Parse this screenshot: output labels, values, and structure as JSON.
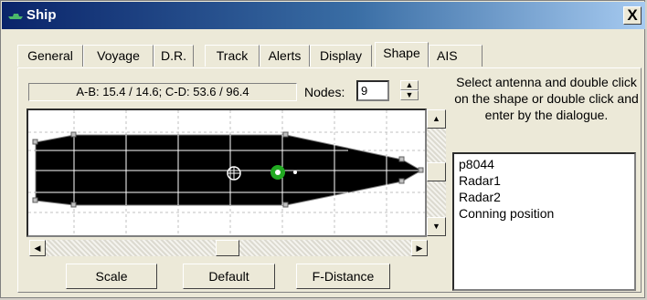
{
  "window": {
    "title": "Ship",
    "close_label": "X"
  },
  "tabs": [
    "General",
    "Voyage",
    "D.R.",
    "Track",
    "Alerts",
    "Display",
    "Shape",
    "AIS"
  ],
  "active_tab": "Shape",
  "info": {
    "measurements": "A-B: 15.4 / 14.6;   C-D: 53.6 / 96.4",
    "nodes_label": "Nodes:",
    "nodes_value": "9"
  },
  "instructions": "Select antenna and double click on the shape or double click and enter by the dialogue.",
  "antennas": [
    "p8044",
    "Radar1",
    "Radar2",
    "Conning position"
  ],
  "buttons": {
    "scale": "Scale",
    "default": "Default",
    "fdistance": "F-Distance"
  },
  "colors": {
    "hull_fill": "#000000",
    "grid_line": "#c0c0c0",
    "antenna_marker": "#22aa22",
    "title_bar": "#0a246a"
  },
  "icons": {
    "title": "ship-icon",
    "close": "close-icon",
    "antenna": "antenna-marker-icon",
    "center": "center-marker-icon"
  }
}
